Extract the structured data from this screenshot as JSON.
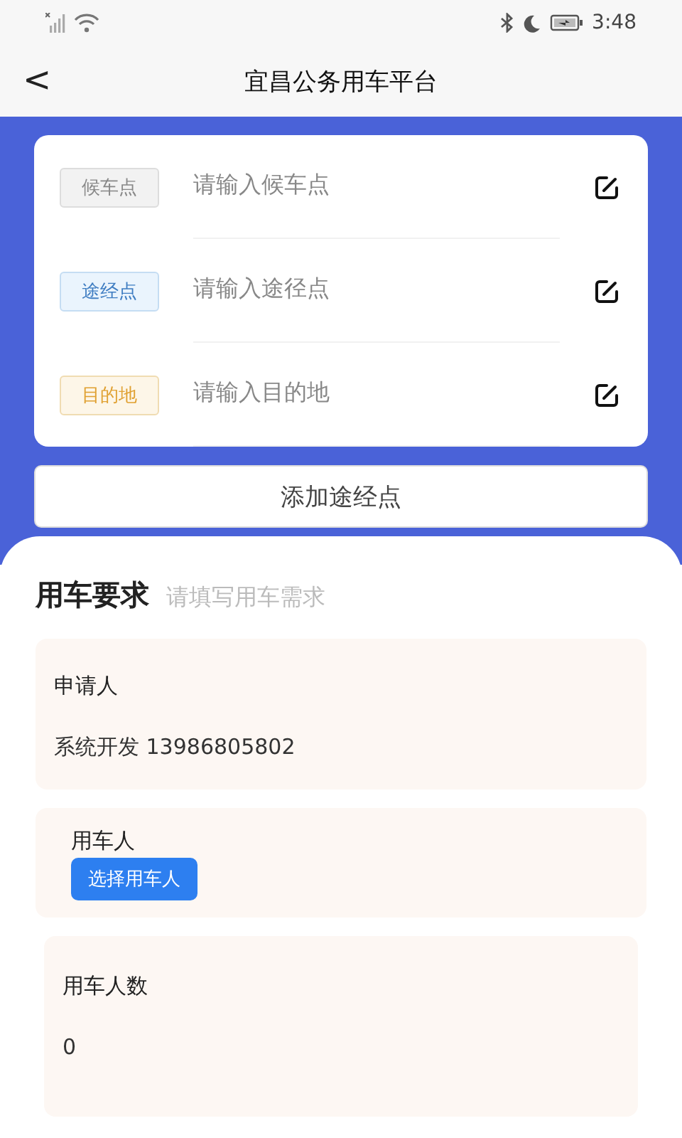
{
  "status_bar": {
    "time": "3:48"
  },
  "header": {
    "back": "<",
    "title": "宜昌公务用车平台"
  },
  "stops": [
    {
      "kind": "pickup",
      "tag": "候车点",
      "placeholder": "请输入候车点"
    },
    {
      "kind": "via",
      "tag": "途经点",
      "placeholder": "请输入途径点"
    },
    {
      "kind": "destination",
      "tag": "目的地",
      "placeholder": "请输入目的地"
    }
  ],
  "add_button": "添加途经点",
  "requirements": {
    "title": "用车要求",
    "hint": "请填写用车需求",
    "applicant": {
      "label": "申请人",
      "value": "系统开发 13986805802"
    },
    "user": {
      "label": "用车人",
      "button": "选择用车人"
    },
    "count": {
      "label": "用车人数",
      "value": "0"
    }
  }
}
